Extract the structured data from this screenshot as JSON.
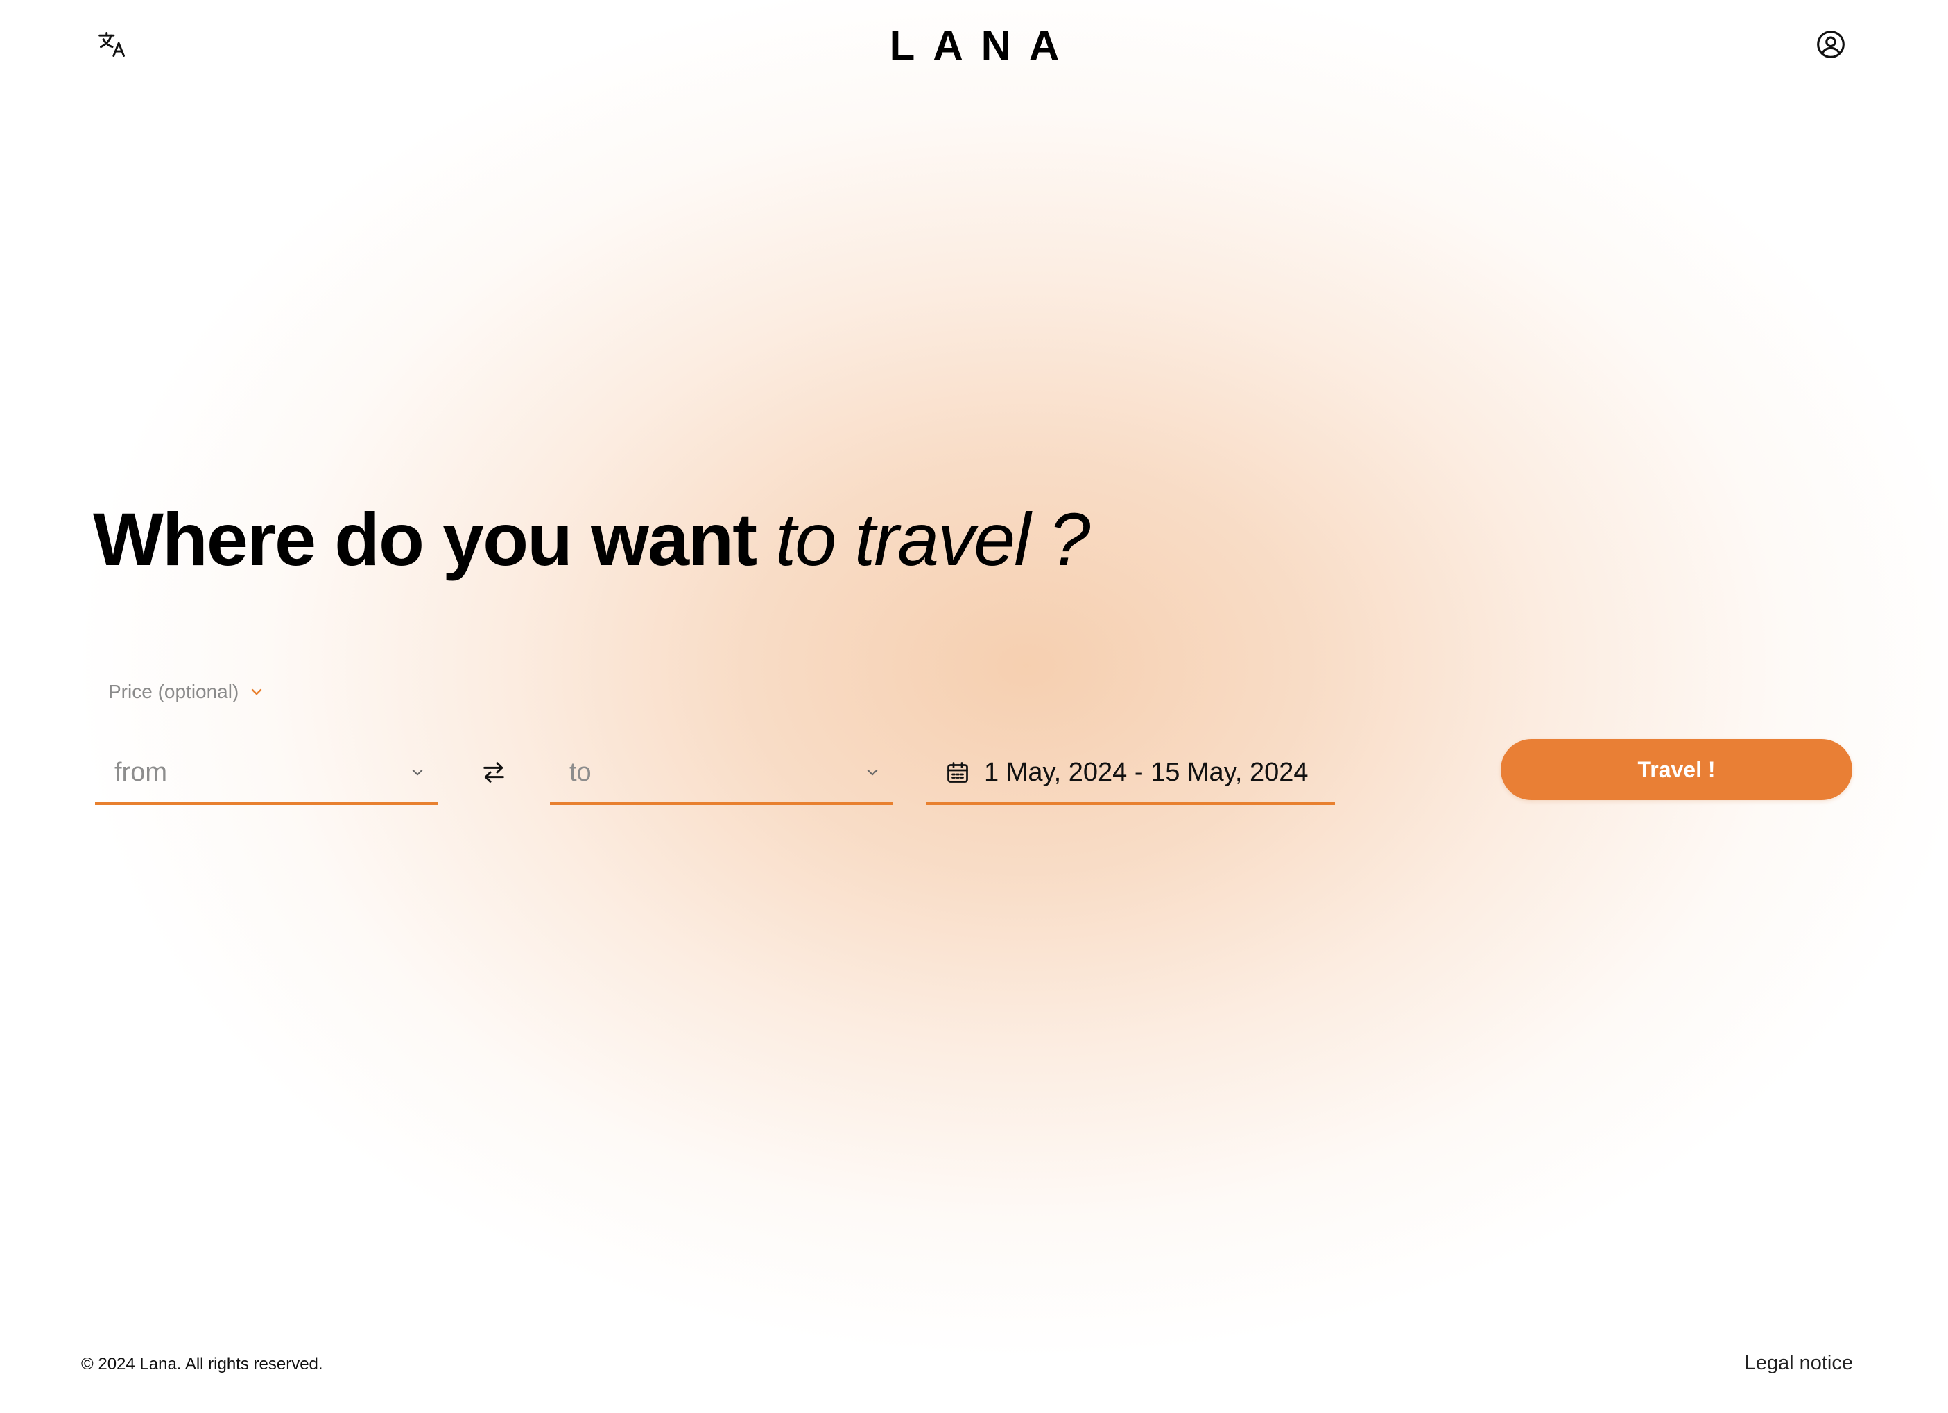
{
  "brand": {
    "logo_text": "LANA",
    "accent_color": "#e97f35",
    "glow_color": "#f2b27f"
  },
  "header": {
    "language_icon": "translate-icon",
    "account_icon": "user-circle-icon"
  },
  "hero": {
    "headline_strong": "Where do you want",
    "headline_light": "to travel ?"
  },
  "search": {
    "price_toggle_label": "Price (optional)",
    "from_placeholder": "from",
    "to_placeholder": "to",
    "swap_icon": "swap-arrows-icon",
    "date_icon": "calendar-icon",
    "date_range": "1 May, 2024 - 15 May, 2024",
    "submit_label": "Travel !"
  },
  "footer": {
    "copyright": "© 2024 Lana. All rights reserved.",
    "legal_link": "Legal notice"
  }
}
